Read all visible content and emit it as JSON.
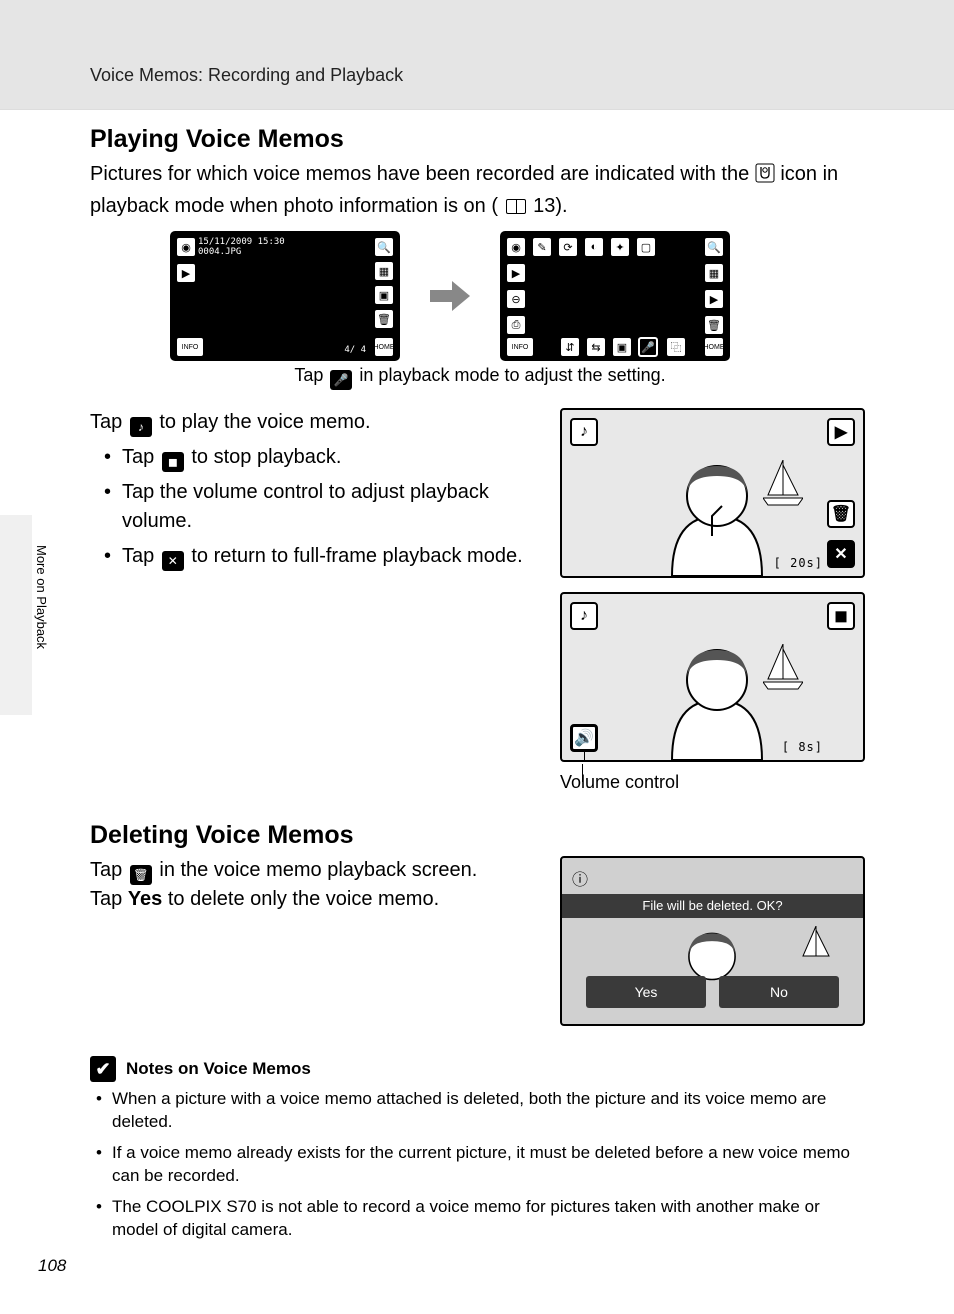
{
  "header": {
    "section_title": "Voice Memos: Recording and Playback"
  },
  "side": {
    "text": "More on Playback"
  },
  "page_number": "108",
  "h_playing": "Playing Voice Memos",
  "intro_a": "Pictures for which voice memos have been recorded are indicated with the ",
  "intro_b": " icon in playback mode when photo information is on (",
  "intro_ref": " 13).",
  "screen1": {
    "date": "15/11/2009 15:30",
    "file": "0004.JPG",
    "counter": "4/   4",
    "info": "INFO",
    "home": "HOME"
  },
  "screen2": {
    "info": "INFO",
    "home": "HOME"
  },
  "caption": {
    "pre": "Tap ",
    "post": " in playback mode to adjust the setting."
  },
  "tap_play": {
    "a": "Tap ",
    "b": " to play the voice memo."
  },
  "bul1": {
    "a": "Tap ",
    "b": " to stop playback."
  },
  "bul2": "Tap the volume control to adjust playback volume.",
  "bul3": {
    "a": "Tap ",
    "b": " to return to full-frame playback mode."
  },
  "timer1": "[    20s]",
  "timer2": "[     8s]",
  "vol_label": "Volume control",
  "h_delete": "Deleting Voice Memos",
  "del1": {
    "a": "Tap ",
    "b": " in the voice memo playback screen."
  },
  "del2": {
    "a": "Tap ",
    "bold": "Yes",
    "b": " to delete only the voice memo."
  },
  "confirm": {
    "msg": "File will be deleted. OK?",
    "yes": "Yes",
    "no": "No"
  },
  "notes_hdr": "Notes on Voice Memos",
  "note1": "When a picture with a voice memo attached is deleted, both the picture and its voice memo are deleted.",
  "note2": "If a voice memo already exists for the current picture, it must be deleted before a new voice memo can be recorded.",
  "note3": "The COOLPIX S70 is not able to record a voice memo for pictures taken with another make or model of digital camera."
}
